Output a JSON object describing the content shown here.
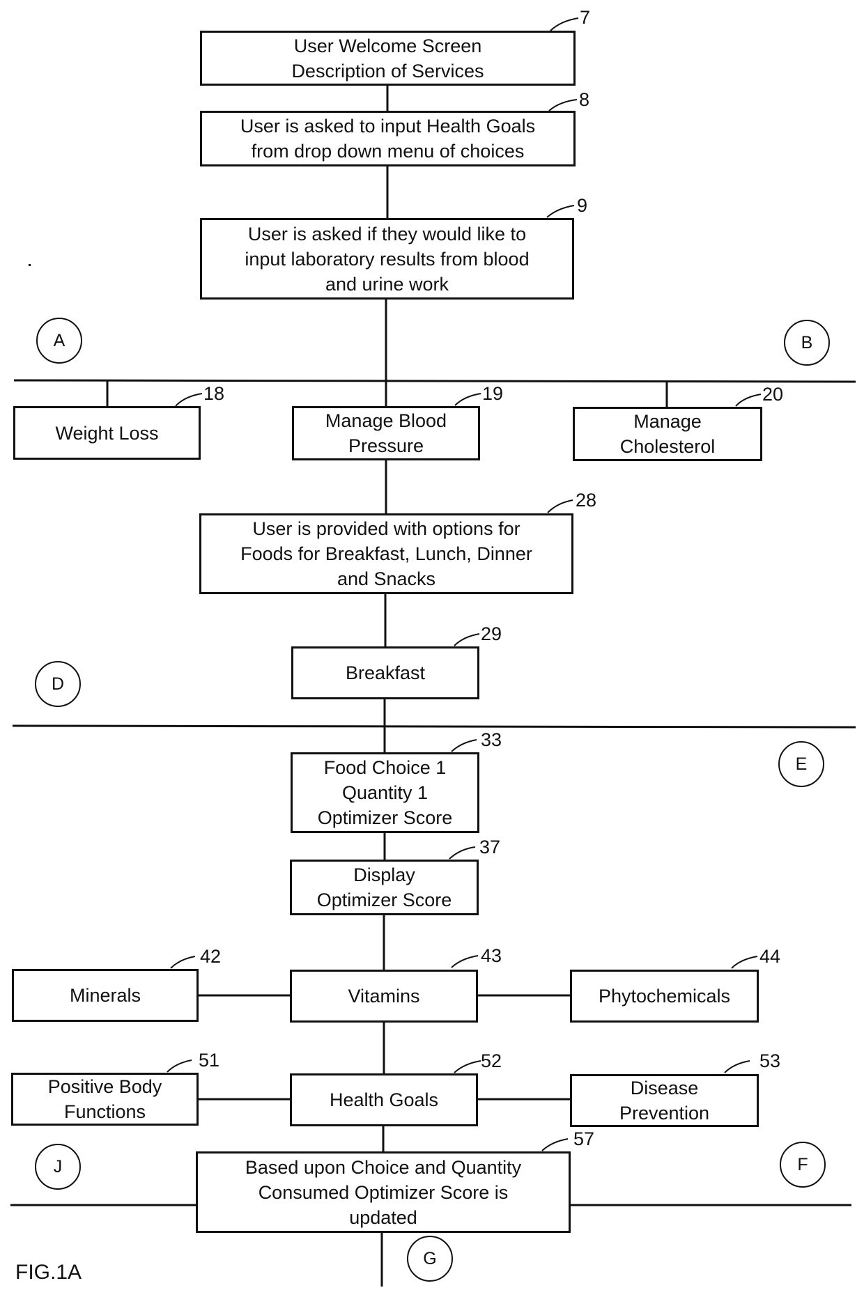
{
  "figure": {
    "label": "FIG.1A",
    "ink_color": "#111111",
    "background": "#ffffff"
  },
  "boxes": {
    "b7": {
      "ref": "7",
      "lines": [
        "User Welcome Screen",
        "Description of Services"
      ]
    },
    "b8": {
      "ref": "8",
      "lines": [
        "User is asked to input Health Goals",
        "from drop down menu of choices"
      ]
    },
    "b9": {
      "ref": "9",
      "lines": [
        "User is asked if they would like to",
        "input laboratory results from blood",
        "and urine work"
      ]
    },
    "b18": {
      "ref": "18",
      "lines": [
        "Weight Loss"
      ]
    },
    "b19": {
      "ref": "19",
      "lines": [
        "Manage Blood",
        "Pressure"
      ]
    },
    "b20": {
      "ref": "20",
      "lines": [
        "Manage",
        "Cholesterol"
      ]
    },
    "b28": {
      "ref": "28",
      "lines": [
        "User is provided with options for",
        "Foods for Breakfast, Lunch, Dinner",
        "and Snacks"
      ]
    },
    "b29": {
      "ref": "29",
      "lines": [
        "Breakfast"
      ]
    },
    "b33": {
      "ref": "33",
      "lines": [
        "Food Choice 1",
        "Quantity 1",
        "Optimizer Score"
      ]
    },
    "b37": {
      "ref": "37",
      "lines": [
        "Display",
        "Optimizer Score"
      ]
    },
    "b42": {
      "ref": "42",
      "lines": [
        "Minerals"
      ]
    },
    "b43": {
      "ref": "43",
      "lines": [
        "Vitamins"
      ]
    },
    "b44": {
      "ref": "44",
      "lines": [
        "Phytochemicals"
      ]
    },
    "b51": {
      "ref": "51",
      "lines": [
        "Positive Body",
        "Functions"
      ]
    },
    "b52": {
      "ref": "52",
      "lines": [
        "Health Goals"
      ]
    },
    "b53": {
      "ref": "53",
      "lines": [
        "Disease",
        "Prevention"
      ]
    },
    "b57": {
      "ref": "57",
      "lines": [
        "Based upon Choice and Quantity",
        "Consumed Optimizer Score is",
        "updated"
      ]
    }
  },
  "connectors": {
    "A": "A",
    "B": "B",
    "D": "D",
    "E": "E",
    "F": "F",
    "G": "G",
    "J": "J"
  }
}
